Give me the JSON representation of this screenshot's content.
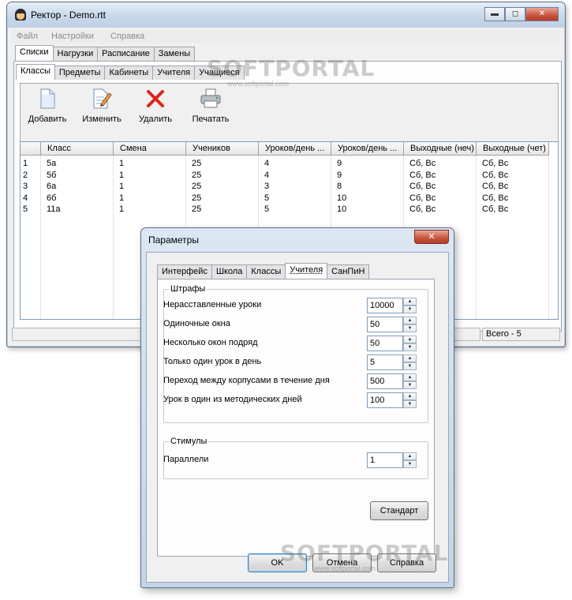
{
  "main_window": {
    "title": "Ректор - Demo.rtt",
    "menu": [
      "Файл",
      "Настройки",
      "Справка"
    ],
    "top_tabs": [
      "Списки",
      "Нагрузки",
      "Расписание",
      "Замены"
    ],
    "sub_tabs": [
      "Классы",
      "Предметы",
      "Кабинеты",
      "Учителя",
      "Учащиеся"
    ],
    "toolbar": {
      "add": "Добавить",
      "edit": "Изменить",
      "delete": "Удалить",
      "print": "Печатать"
    },
    "table": {
      "columns": [
        "",
        "Класс",
        "Смена",
        "Учеников",
        "Уроков/день ...",
        "Уроков/день ...",
        "Выходные (неч)",
        "Выходные (чет)"
      ],
      "rows": [
        [
          "1",
          "5а",
          "1",
          "25",
          "4",
          "9",
          "Сб, Вс",
          "Сб, Вс"
        ],
        [
          "2",
          "5б",
          "1",
          "25",
          "4",
          "9",
          "Сб, Вс",
          "Сб, Вс"
        ],
        [
          "3",
          "6а",
          "1",
          "25",
          "3",
          "8",
          "Сб, Вс",
          "Сб, Вс"
        ],
        [
          "4",
          "6б",
          "1",
          "25",
          "5",
          "10",
          "Сб, Вс",
          "Сб, Вс"
        ],
        [
          "5",
          "11а",
          "1",
          "25",
          "5",
          "10",
          "Сб, Вс",
          "Сб, Вс"
        ]
      ]
    },
    "status": {
      "left": "",
      "total": "Всего - 5"
    }
  },
  "watermark": {
    "brand": "SOFTPORTAL",
    "url": "www.softportal.com"
  },
  "dialog": {
    "title": "Параметры",
    "tabs": [
      "Интерфейс",
      "Школа",
      "Классы",
      "Учителя",
      "СанПиН"
    ],
    "penalties_label": "Штрафы",
    "penalties": [
      {
        "label": "Нерасставленные уроки",
        "value": "10000"
      },
      {
        "label": "Одиночные окна",
        "value": "50"
      },
      {
        "label": "Несколько окон подряд",
        "value": "50"
      },
      {
        "label": "Только один урок в день",
        "value": "5"
      },
      {
        "label": "Переход между корпусами в течение дня",
        "value": "500"
      },
      {
        "label": "Урок в один из методических дней",
        "value": "100"
      }
    ],
    "stimuli_label": "Стимулы",
    "stimuli": [
      {
        "label": "Параллели",
        "value": "1"
      }
    ],
    "standard_button": "Стандарт",
    "ok_button": "OK",
    "cancel_button": "Отмена",
    "help_button": "Справка"
  }
}
